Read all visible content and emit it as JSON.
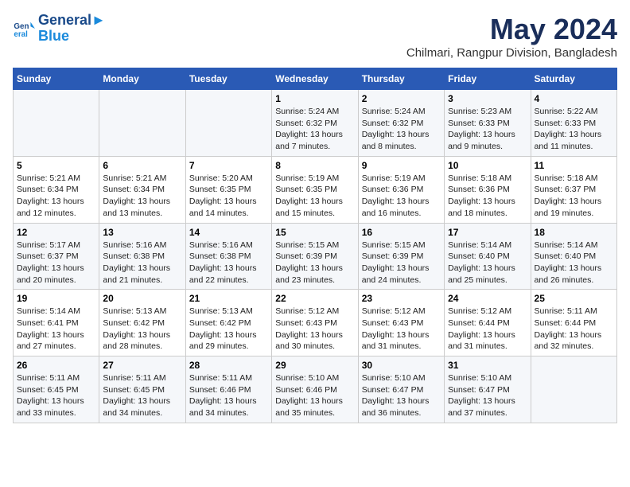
{
  "logo": {
    "line1": "General",
    "line2": "Blue"
  },
  "title": "May 2024",
  "subtitle": "Chilmari, Rangpur Division, Bangladesh",
  "days_header": [
    "Sunday",
    "Monday",
    "Tuesday",
    "Wednesday",
    "Thursday",
    "Friday",
    "Saturday"
  ],
  "weeks": [
    [
      {
        "day": "",
        "info": ""
      },
      {
        "day": "",
        "info": ""
      },
      {
        "day": "",
        "info": ""
      },
      {
        "day": "1",
        "info": "Sunrise: 5:24 AM\nSunset: 6:32 PM\nDaylight: 13 hours and 7 minutes."
      },
      {
        "day": "2",
        "info": "Sunrise: 5:24 AM\nSunset: 6:32 PM\nDaylight: 13 hours and 8 minutes."
      },
      {
        "day": "3",
        "info": "Sunrise: 5:23 AM\nSunset: 6:33 PM\nDaylight: 13 hours and 9 minutes."
      },
      {
        "day": "4",
        "info": "Sunrise: 5:22 AM\nSunset: 6:33 PM\nDaylight: 13 hours and 11 minutes."
      }
    ],
    [
      {
        "day": "5",
        "info": "Sunrise: 5:21 AM\nSunset: 6:34 PM\nDaylight: 13 hours and 12 minutes."
      },
      {
        "day": "6",
        "info": "Sunrise: 5:21 AM\nSunset: 6:34 PM\nDaylight: 13 hours and 13 minutes."
      },
      {
        "day": "7",
        "info": "Sunrise: 5:20 AM\nSunset: 6:35 PM\nDaylight: 13 hours and 14 minutes."
      },
      {
        "day": "8",
        "info": "Sunrise: 5:19 AM\nSunset: 6:35 PM\nDaylight: 13 hours and 15 minutes."
      },
      {
        "day": "9",
        "info": "Sunrise: 5:19 AM\nSunset: 6:36 PM\nDaylight: 13 hours and 16 minutes."
      },
      {
        "day": "10",
        "info": "Sunrise: 5:18 AM\nSunset: 6:36 PM\nDaylight: 13 hours and 18 minutes."
      },
      {
        "day": "11",
        "info": "Sunrise: 5:18 AM\nSunset: 6:37 PM\nDaylight: 13 hours and 19 minutes."
      }
    ],
    [
      {
        "day": "12",
        "info": "Sunrise: 5:17 AM\nSunset: 6:37 PM\nDaylight: 13 hours and 20 minutes."
      },
      {
        "day": "13",
        "info": "Sunrise: 5:16 AM\nSunset: 6:38 PM\nDaylight: 13 hours and 21 minutes."
      },
      {
        "day": "14",
        "info": "Sunrise: 5:16 AM\nSunset: 6:38 PM\nDaylight: 13 hours and 22 minutes."
      },
      {
        "day": "15",
        "info": "Sunrise: 5:15 AM\nSunset: 6:39 PM\nDaylight: 13 hours and 23 minutes."
      },
      {
        "day": "16",
        "info": "Sunrise: 5:15 AM\nSunset: 6:39 PM\nDaylight: 13 hours and 24 minutes."
      },
      {
        "day": "17",
        "info": "Sunrise: 5:14 AM\nSunset: 6:40 PM\nDaylight: 13 hours and 25 minutes."
      },
      {
        "day": "18",
        "info": "Sunrise: 5:14 AM\nSunset: 6:40 PM\nDaylight: 13 hours and 26 minutes."
      }
    ],
    [
      {
        "day": "19",
        "info": "Sunrise: 5:14 AM\nSunset: 6:41 PM\nDaylight: 13 hours and 27 minutes."
      },
      {
        "day": "20",
        "info": "Sunrise: 5:13 AM\nSunset: 6:42 PM\nDaylight: 13 hours and 28 minutes."
      },
      {
        "day": "21",
        "info": "Sunrise: 5:13 AM\nSunset: 6:42 PM\nDaylight: 13 hours and 29 minutes."
      },
      {
        "day": "22",
        "info": "Sunrise: 5:12 AM\nSunset: 6:43 PM\nDaylight: 13 hours and 30 minutes."
      },
      {
        "day": "23",
        "info": "Sunrise: 5:12 AM\nSunset: 6:43 PM\nDaylight: 13 hours and 31 minutes."
      },
      {
        "day": "24",
        "info": "Sunrise: 5:12 AM\nSunset: 6:44 PM\nDaylight: 13 hours and 31 minutes."
      },
      {
        "day": "25",
        "info": "Sunrise: 5:11 AM\nSunset: 6:44 PM\nDaylight: 13 hours and 32 minutes."
      }
    ],
    [
      {
        "day": "26",
        "info": "Sunrise: 5:11 AM\nSunset: 6:45 PM\nDaylight: 13 hours and 33 minutes."
      },
      {
        "day": "27",
        "info": "Sunrise: 5:11 AM\nSunset: 6:45 PM\nDaylight: 13 hours and 34 minutes."
      },
      {
        "day": "28",
        "info": "Sunrise: 5:11 AM\nSunset: 6:46 PM\nDaylight: 13 hours and 34 minutes."
      },
      {
        "day": "29",
        "info": "Sunrise: 5:10 AM\nSunset: 6:46 PM\nDaylight: 13 hours and 35 minutes."
      },
      {
        "day": "30",
        "info": "Sunrise: 5:10 AM\nSunset: 6:47 PM\nDaylight: 13 hours and 36 minutes."
      },
      {
        "day": "31",
        "info": "Sunrise: 5:10 AM\nSunset: 6:47 PM\nDaylight: 13 hours and 37 minutes."
      },
      {
        "day": "",
        "info": ""
      }
    ]
  ]
}
